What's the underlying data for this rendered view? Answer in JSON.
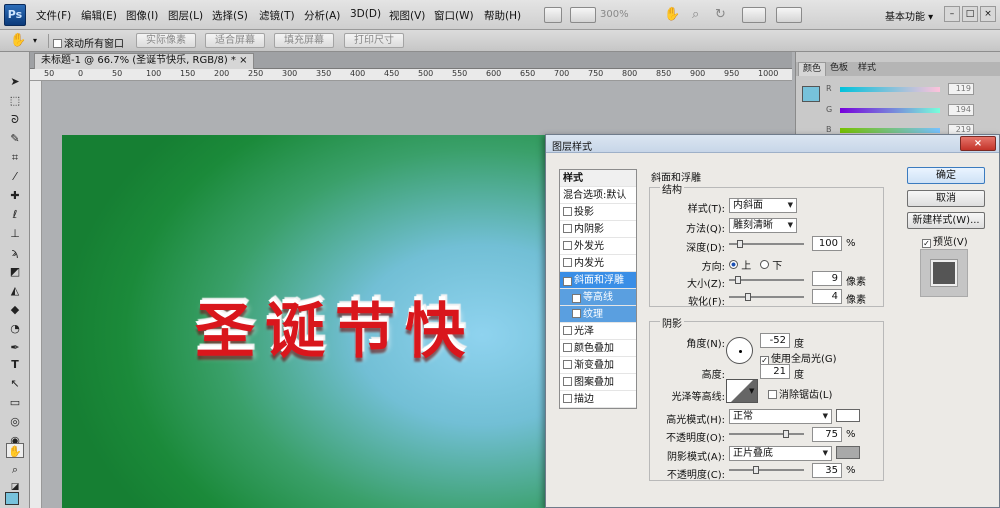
{
  "app": {
    "logo": "Ps",
    "workspace": "基本功能",
    "zoom": "300%"
  },
  "menu": [
    "文件(F)",
    "编辑(E)",
    "图像(I)",
    "图层(L)",
    "选择(S)",
    "滤镜(T)",
    "分析(A)",
    "3D(D)",
    "视图(V)",
    "窗口(W)",
    "帮助(H)"
  ],
  "options": {
    "scroll_all": "滚动所有窗口",
    "buttons": [
      "实际像素",
      "适合屏幕",
      "填充屏幕",
      "打印尺寸"
    ]
  },
  "document": {
    "tab_title": "未标题-1 @ 66.7% (圣诞节快乐, RGB/8) *",
    "ruler_top": [
      "50",
      "0",
      "50",
      "100",
      "150",
      "200",
      "250",
      "300",
      "350",
      "400",
      "450",
      "500",
      "550",
      "600",
      "650",
      "700",
      "750",
      "800",
      "850",
      "900",
      "950",
      "1000"
    ],
    "text": "圣诞节快"
  },
  "color_panel": {
    "tabs": [
      "颜色",
      "色板",
      "样式"
    ],
    "labels": [
      "R",
      "G",
      "B"
    ],
    "values": [
      "119",
      "194",
      "219"
    ],
    "swatch": "#77c2db"
  },
  "dialog": {
    "title": "图层样式",
    "list_header": "样式",
    "list_items": [
      {
        "label": "混合选项:默认",
        "checkbox": false,
        "checked": false
      },
      {
        "label": "投影",
        "checkbox": true,
        "checked": false
      },
      {
        "label": "内阴影",
        "checkbox": true,
        "checked": false
      },
      {
        "label": "外发光",
        "checkbox": true,
        "checked": false
      },
      {
        "label": "内发光",
        "checkbox": true,
        "checked": false
      },
      {
        "label": "斜面和浮雕",
        "checkbox": true,
        "checked": true
      },
      {
        "label": "等高线",
        "checkbox": true,
        "checked": true
      },
      {
        "label": "纹理",
        "checkbox": true,
        "checked": false
      },
      {
        "label": "光泽",
        "checkbox": true,
        "checked": false
      },
      {
        "label": "颜色叠加",
        "checkbox": true,
        "checked": false
      },
      {
        "label": "渐变叠加",
        "checkbox": true,
        "checked": false
      },
      {
        "label": "图案叠加",
        "checkbox": true,
        "checked": false
      },
      {
        "label": "描边",
        "checkbox": true,
        "checked": false
      }
    ],
    "bevel": {
      "group_title": "斜面和浮雕",
      "structure_title": "结构",
      "style_label": "样式(T):",
      "style_value": "内斜面",
      "technique_label": "方法(Q):",
      "technique_value": "雕刻清晰",
      "depth_label": "深度(D):",
      "depth_value": "100",
      "depth_unit": "%",
      "direction_label": "方向:",
      "dir_up": "上",
      "dir_down": "下",
      "size_label": "大小(Z):",
      "size_value": "9",
      "size_unit": "像素",
      "soften_label": "软化(F):",
      "soften_value": "4",
      "soften_unit": "像素"
    },
    "shading": {
      "title": "阴影",
      "angle_label": "角度(N):",
      "angle_value": "-52",
      "angle_unit": "度",
      "global_light": "使用全局光(G)",
      "altitude_label": "高度:",
      "altitude_value": "21",
      "altitude_unit": "度",
      "gloss_label": "光泽等高线:",
      "antialias": "消除锯齿(L)",
      "highlight_label": "高光模式(H):",
      "highlight_value": "正常",
      "hl_opacity_label": "不透明度(O):",
      "hl_opacity_value": "75",
      "hl_opacity_unit": "%",
      "shadow_label": "阴影模式(A):",
      "shadow_value": "正片叠底",
      "sh_opacity_label": "不透明度(C):",
      "sh_opacity_value": "35",
      "sh_opacity_unit": "%"
    },
    "buttons": {
      "ok": "确定",
      "cancel": "取消",
      "new_style": "新建样式(W)...",
      "preview": "预览(V)"
    },
    "colors": {
      "highlight": "#ffffff",
      "shadow": "#a9a9a9"
    }
  }
}
